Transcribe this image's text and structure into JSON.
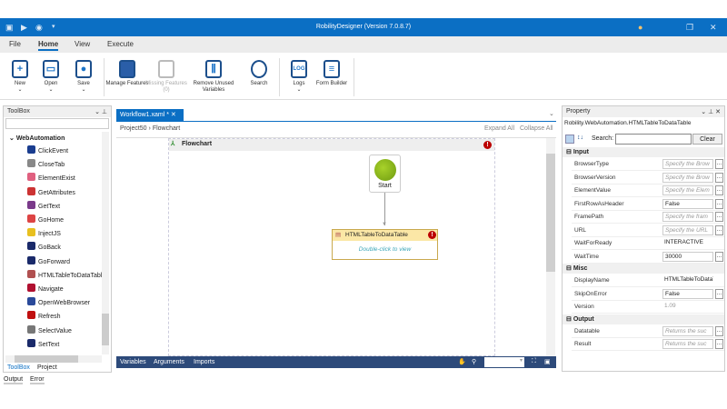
{
  "window": {
    "title": "RobilityDesigner (Version 7.0.8.7)"
  },
  "menu": [
    "File",
    "Home",
    "View",
    "Execute"
  ],
  "ribbon": [
    {
      "label": "New",
      "icon": "new-file-icon"
    },
    {
      "label": "Open",
      "icon": "folder-open-icon"
    },
    {
      "label": "Save",
      "icon": "save-icon"
    },
    {
      "label": "Manage Features",
      "icon": "puzzle-icon"
    },
    {
      "label": "Missing Features (0)",
      "icon": "puzzle-missing-icon"
    },
    {
      "label": "Remove Unused Variables",
      "icon": "trash-icon"
    },
    {
      "label": "Search",
      "icon": "search-icon"
    },
    {
      "label": "Logs",
      "icon": "logs-icon"
    },
    {
      "label": "Form Builder",
      "icon": "form-icon"
    }
  ],
  "toolbox": {
    "title": "ToolBox",
    "category": "WebAutomation",
    "items": [
      {
        "label": "ClickEvent",
        "color": "#1a3d8f"
      },
      {
        "label": "CloseTab",
        "color": "#888"
      },
      {
        "label": "ElementExist",
        "color": "#e06080"
      },
      {
        "label": "GetAttributes",
        "color": "#c33"
      },
      {
        "label": "GetText",
        "color": "#7a3a8a"
      },
      {
        "label": "GoHome",
        "color": "#d44"
      },
      {
        "label": "InjectJS",
        "color": "#e8c020"
      },
      {
        "label": "GoBack",
        "color": "#1a2a6a"
      },
      {
        "label": "GoForward",
        "color": "#1a2a6a"
      },
      {
        "label": "HTMLTableToDataTable",
        "color": "#b05050"
      },
      {
        "label": "Navigate",
        "color": "#b01030"
      },
      {
        "label": "OpenWebBrowser",
        "color": "#2a4a9a"
      },
      {
        "label": "Refresh",
        "color": "#c01010"
      },
      {
        "label": "SelectValue",
        "color": "#777"
      },
      {
        "label": "SetText",
        "color": "#1a2a6a"
      }
    ],
    "tabs": [
      "ToolBox",
      "Project"
    ],
    "bottom_tabs": [
      "Output",
      "Error"
    ]
  },
  "editor": {
    "tab": "Workflow1.xaml *",
    "breadcrumb": [
      "Project50",
      "Flowchart"
    ],
    "expand_all": "Expand All",
    "collapse_all": "Collapse All",
    "flowchart_title": "Flowchart",
    "start_label": "Start",
    "activity_title": "HTMLTableToDataTable",
    "activity_hint": "Double-click to view",
    "bottom": [
      "Variables",
      "Arguments",
      "Imports"
    ]
  },
  "property": {
    "title": "Property",
    "type": "Robility.WebAutomation.HTMLTableToDataTable",
    "search_label": "Search:",
    "clear": "Clear",
    "sections": [
      {
        "name": "Input",
        "rows": [
          {
            "n": "BrowserType",
            "v": "Specify the Brow",
            "ph": true,
            "btn": true
          },
          {
            "n": "BrowserVersion",
            "v": "Specify the Brow",
            "ph": true,
            "btn": true
          },
          {
            "n": "ElementValue",
            "v": "Specify the Elem",
            "ph": true,
            "btn": true
          },
          {
            "n": "FirstRowAsHeader",
            "v": "False",
            "ph": false,
            "btn": true
          },
          {
            "n": "FramePath",
            "v": "Specify the fram",
            "ph": true,
            "btn": true
          },
          {
            "n": "URL",
            "v": "Specify the URL",
            "ph": true,
            "btn": true
          },
          {
            "n": "WaitForReady",
            "v": "INTERACTIVE",
            "ph": false,
            "btn": false
          },
          {
            "n": "WaitTime",
            "v": "30000",
            "ph": false,
            "btn": true
          }
        ]
      },
      {
        "name": "Misc",
        "rows": [
          {
            "n": "DisplayName",
            "v": "HTMLTableToDataTable",
            "ph": false,
            "btn": false
          },
          {
            "n": "SkipOnError",
            "v": "False",
            "ph": false,
            "btn": true
          },
          {
            "n": "Version",
            "v": "1.09",
            "ph": false,
            "btn": false
          }
        ]
      },
      {
        "name": "Output",
        "rows": [
          {
            "n": "Datatable",
            "v": "Returns the suc",
            "ph": true,
            "btn": true
          },
          {
            "n": "Result",
            "v": "Returns the suc",
            "ph": true,
            "btn": true
          }
        ]
      }
    ]
  }
}
